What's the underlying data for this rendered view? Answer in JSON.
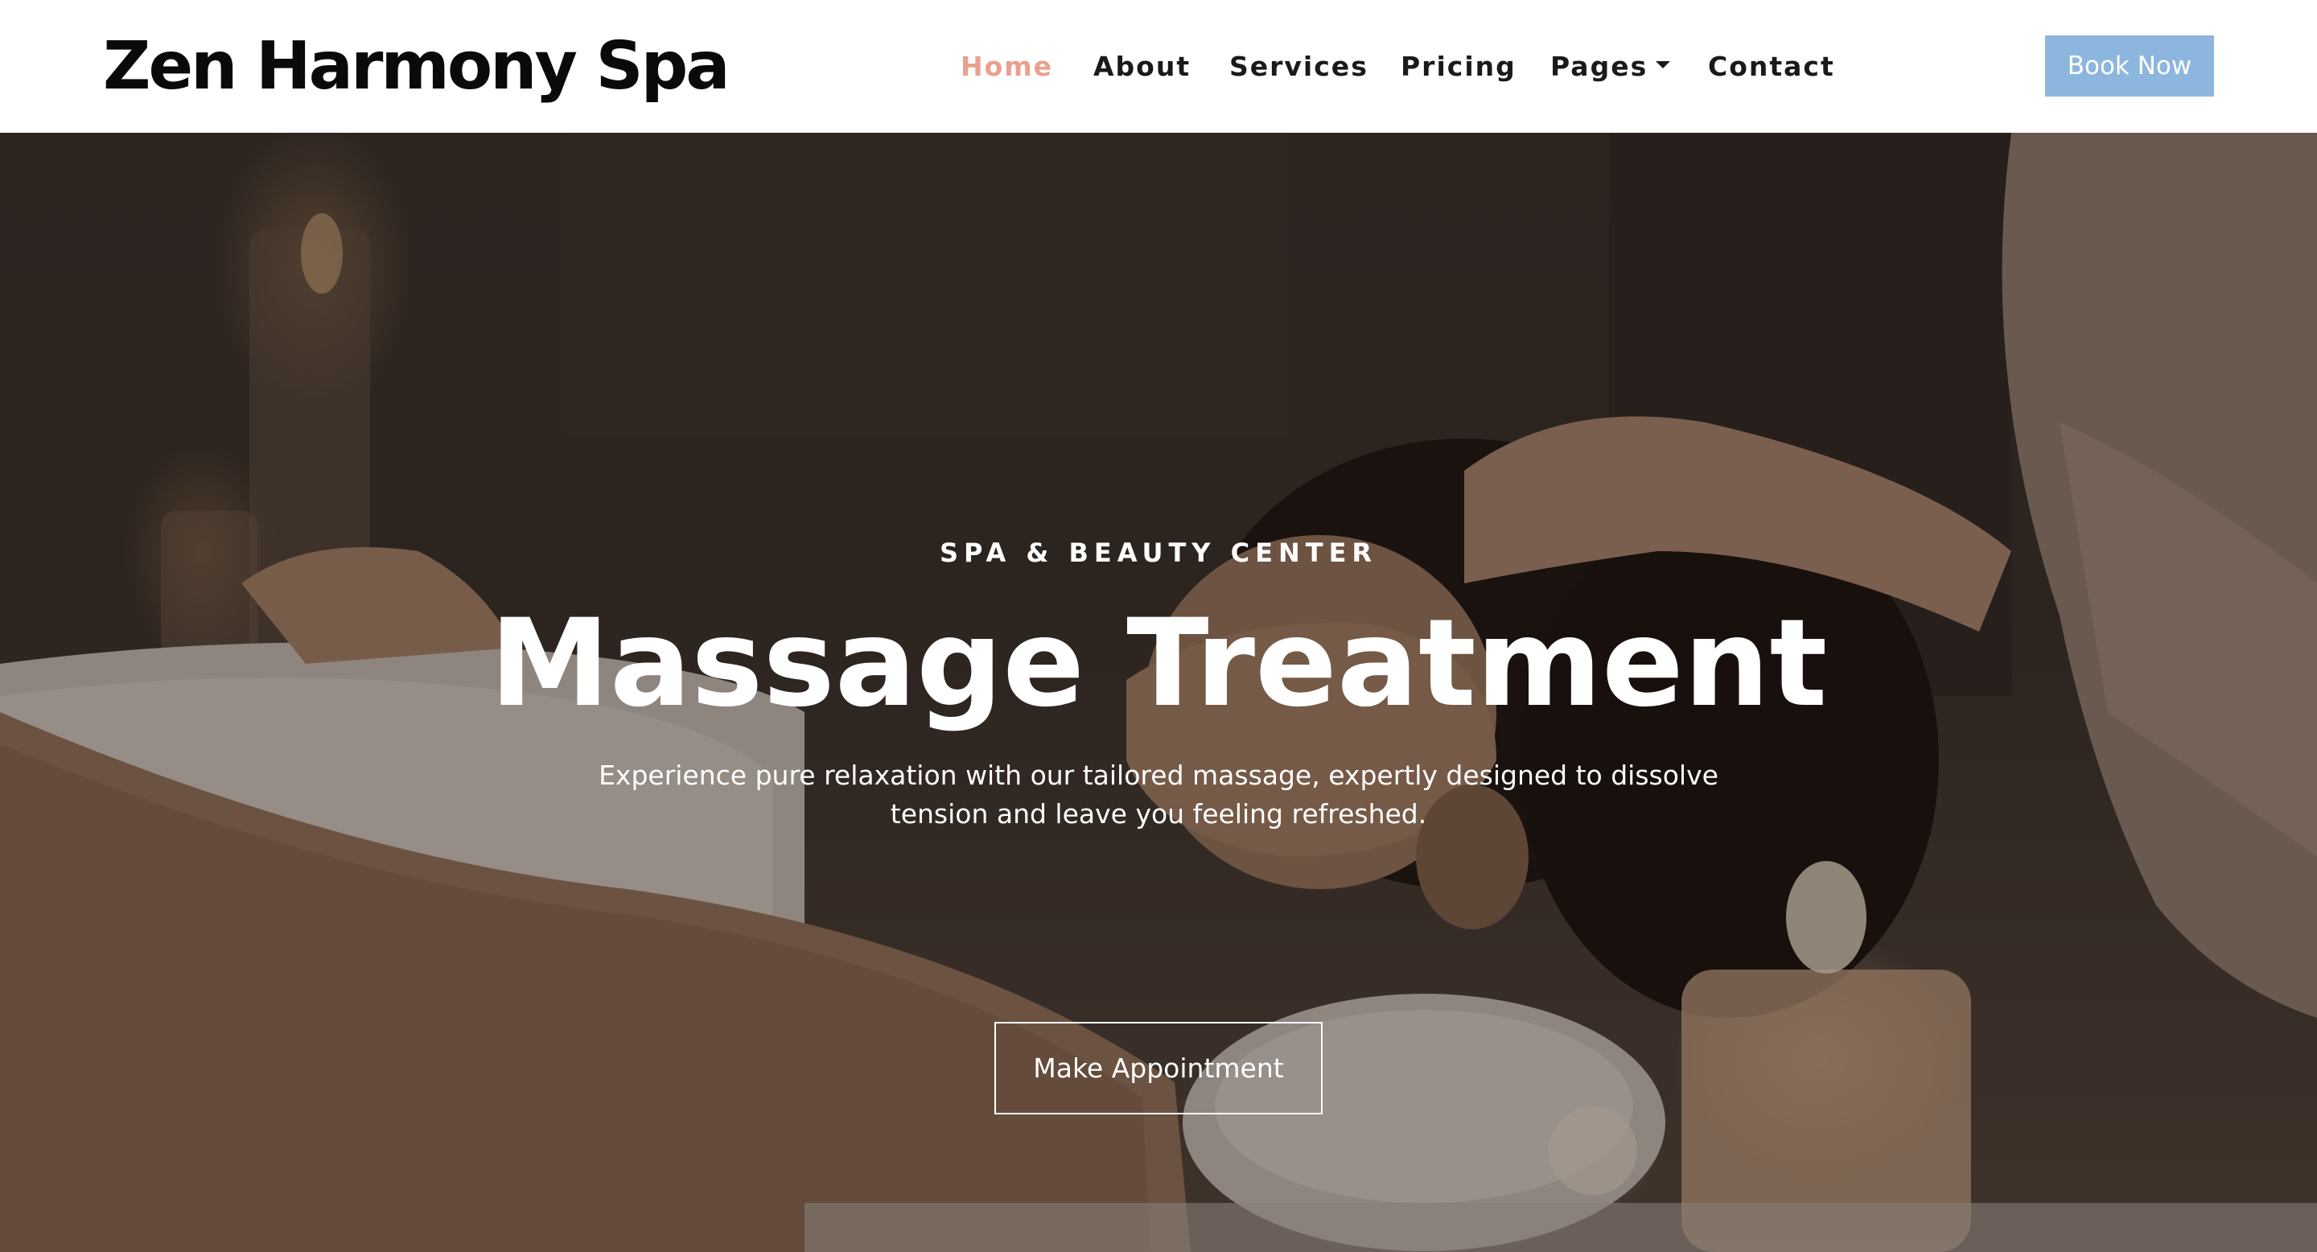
{
  "header": {
    "brand": "Zen Harmony Spa",
    "nav": {
      "home": "Home",
      "about": "About",
      "services": "Services",
      "pricing": "Pricing",
      "pages": "Pages",
      "contact": "Contact"
    },
    "active_item": "Home",
    "book_button": "Book Now"
  },
  "hero": {
    "eyebrow": "SPA & BEAUTY CENTER",
    "title": "Massage Treatment",
    "description": "Experience pure relaxation with our tailored massage, expertly designed to dissolve tension and leave you feeling refreshed.",
    "cta_button": "Make Appointment",
    "background_image": "woman receiving a face and head massage lying on a towel with candles around"
  },
  "colors": {
    "brand_text": "#0a0a0a",
    "nav_active": "#e8a18e",
    "nav_text": "#1a1a1a",
    "book_button_bg": "#8cb6dd",
    "hero_text": "#ffffff"
  },
  "icons": {
    "pages_dropdown": "caret-down-icon"
  }
}
